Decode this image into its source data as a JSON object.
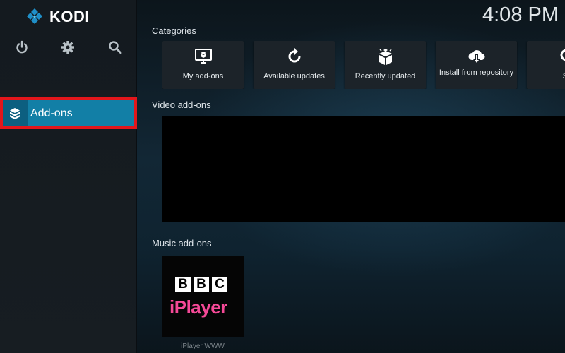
{
  "app": {
    "name": "KODI",
    "clock": "4:08 PM"
  },
  "sidebar": {
    "top_icons": [
      "power-icon",
      "gear-icon",
      "search-icon"
    ],
    "items": [
      {
        "label": "Add-ons",
        "icon": "addons-box-icon",
        "selected": true
      }
    ],
    "highlight_color": "#e3161b",
    "selected_color": "#127fa6"
  },
  "sections": {
    "categories": {
      "title": "Categories",
      "tiles": [
        {
          "label": "My add-ons",
          "icon": "monitor-box-icon"
        },
        {
          "label": "Available updates",
          "icon": "refresh-icon"
        },
        {
          "label": "Recently updated",
          "icon": "open-box-icon"
        },
        {
          "label": "Install from repository",
          "icon": "cloud-download-icon"
        },
        {
          "label": "Se",
          "icon": "search-icon"
        }
      ]
    },
    "video": {
      "title": "Video add-ons"
    },
    "music": {
      "title": "Music add-ons",
      "items": [
        {
          "logo_line1": [
            "B",
            "B",
            "C"
          ],
          "logo_line2": "iPlayer",
          "caption": "iPlayer WWW"
        }
      ]
    }
  }
}
